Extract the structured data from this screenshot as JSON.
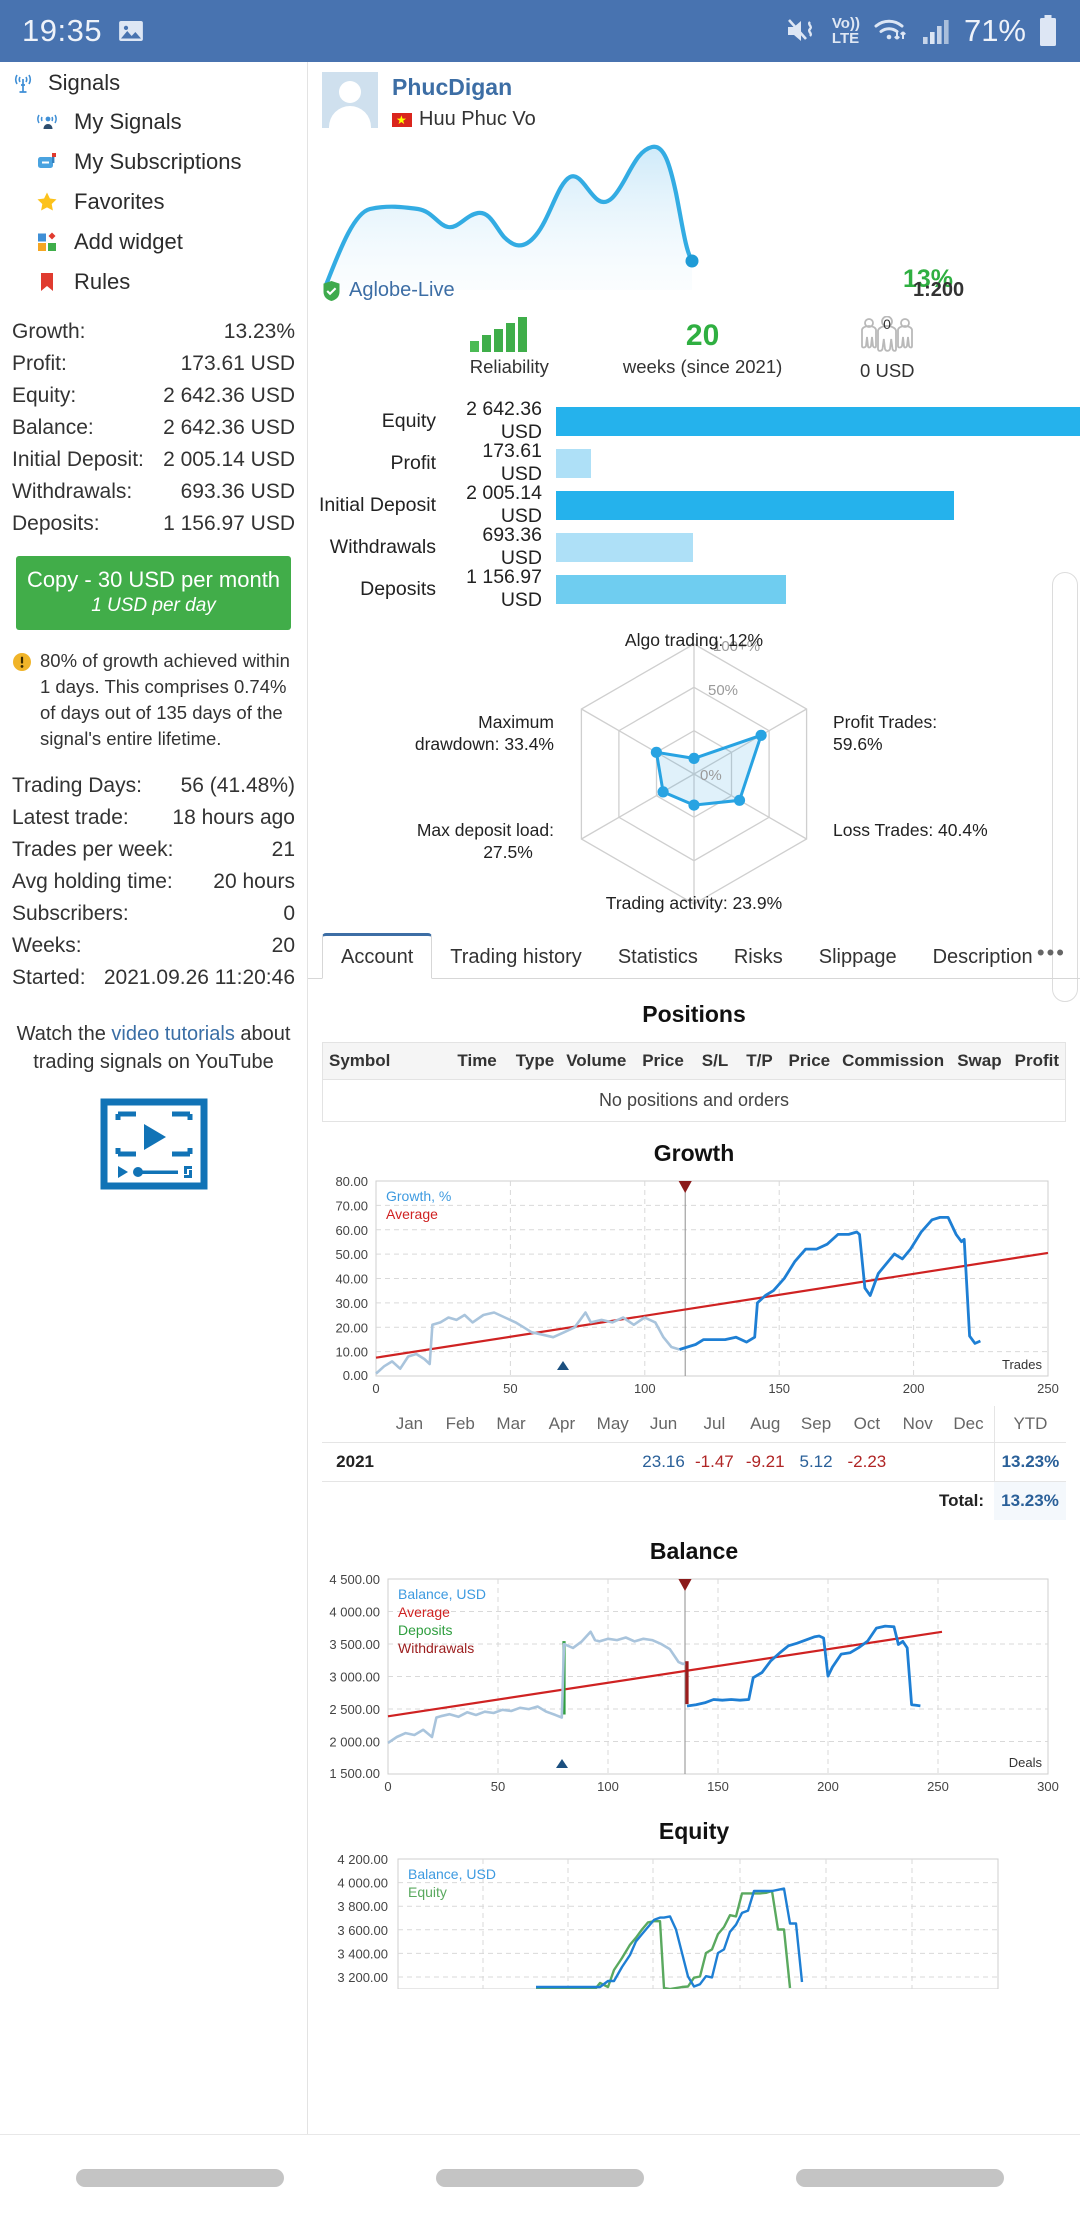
{
  "statusbar": {
    "time": "19:35",
    "battery": "71%",
    "network_label": "Vo))",
    "network_label2": "LTE",
    "icons": [
      "image-icon",
      "mute-vibrate-icon",
      "volte-icon",
      "wifi-icon",
      "signal-icon",
      "battery-icon"
    ]
  },
  "sidebar": {
    "root": {
      "label": "Signals",
      "icon": "antenna-icon"
    },
    "items": [
      {
        "label": "My Signals",
        "icon": "signal-person-icon"
      },
      {
        "label": "My Subscriptions",
        "icon": "mailbox-icon"
      },
      {
        "label": "Favorites",
        "icon": "star-icon"
      },
      {
        "label": "Add widget",
        "icon": "widget-icon"
      },
      {
        "label": "Rules",
        "icon": "bookmark-icon"
      }
    ],
    "stats": [
      {
        "key": "Growth:",
        "value": "13.23%"
      },
      {
        "key": "Profit:",
        "value": "173.61 USD"
      },
      {
        "key": "Equity:",
        "value": "2 642.36 USD"
      },
      {
        "key": "Balance:",
        "value": "2 642.36 USD"
      },
      {
        "key": "Initial Deposit:",
        "value": "2 005.14 USD"
      },
      {
        "key": "Withdrawals:",
        "value": "693.36 USD"
      },
      {
        "key": "Deposits:",
        "value": "1 156.97 USD"
      }
    ],
    "copy_button": {
      "line1": "Copy - 30 USD per month",
      "line2": "1 USD per day"
    },
    "warning": "80% of growth achieved within 1 days. This comprises 0.74% of days out of 135 days of the signal's entire lifetime.",
    "stats2": [
      {
        "key": "Trading Days:",
        "value": "56 (41.48%)"
      },
      {
        "key": "Latest trade:",
        "value": "18 hours ago"
      },
      {
        "key": "Trades per week:",
        "value": "21"
      },
      {
        "key": "Avg holding time:",
        "value": "20 hours"
      },
      {
        "key": "Subscribers:",
        "value": "0"
      },
      {
        "key": "Weeks:",
        "value": "20"
      },
      {
        "key": "Started:",
        "value": "2021.09.26 11:20:46"
      }
    ],
    "youtube": {
      "pre": "Watch the ",
      "link": "video tutorials",
      "post": " about trading signals on YouTube"
    }
  },
  "profile": {
    "name": "PhucDigan",
    "real_name": "Huu Phuc Vo",
    "country_flag": "vietnam-flag",
    "growth_percent": "13%",
    "broker": "Aglobe-Live",
    "leverage": "1:200",
    "reliability_label": "Reliability",
    "weeks_value": "20",
    "weeks_label": "weeks (since 2021)",
    "subscribers_badge": "0",
    "subscribers_value": "0 USD"
  },
  "bars": {
    "rows": [
      {
        "label": "Equity",
        "value": "2 642.36 USD",
        "pct": 100,
        "color": "#25b2ec"
      },
      {
        "label": "Profit",
        "value": "173.61 USD",
        "pct": 6.6,
        "color": "#aee0f7"
      },
      {
        "label": "Initial Deposit",
        "value": "2 005.14 USD",
        "pct": 75.9,
        "color": "#25b2ec"
      },
      {
        "label": "Withdrawals",
        "value": "693.36 USD",
        "pct": 26.2,
        "color": "#aee0f7"
      },
      {
        "label": "Deposits",
        "value": "1 156.97 USD",
        "pct": 43.8,
        "color": "#6fcdf0"
      }
    ]
  },
  "tabs": {
    "items": [
      "Account",
      "Trading history",
      "Statistics",
      "Risks",
      "Slippage",
      "Description"
    ],
    "active": "Account",
    "overflow": "•••"
  },
  "positions": {
    "title": "Positions",
    "columns": [
      "Symbol",
      "Time",
      "Type",
      "Volume",
      "Price",
      "S/L",
      "T/P",
      "Price",
      "Commission",
      "Swap",
      "Profit"
    ],
    "empty_text": "No positions and orders"
  },
  "monthly": {
    "months": [
      "Jan",
      "Feb",
      "Mar",
      "Apr",
      "May",
      "Jun",
      "Jul",
      "Aug",
      "Sep",
      "Oct",
      "Nov",
      "Dec"
    ],
    "ytd_header": "YTD",
    "year": "2021",
    "values": [
      "",
      "",
      "",
      "",
      "",
      "23.16",
      "-1.47",
      "-9.21",
      "5.12",
      "-2.23",
      "",
      ""
    ],
    "ytd": "13.23%",
    "total_label": "Total:",
    "total_value": "13.23%"
  },
  "chart_data": [
    {
      "type": "line",
      "title": "Growth",
      "xlabel": "Trades",
      "ylabel": "",
      "legend": [
        "Growth, %",
        "Average"
      ],
      "legend_colors": [
        "#3d9ae0",
        "#cf2222"
      ],
      "xlim": [
        0,
        250
      ],
      "xticks": [
        0,
        50,
        100,
        150,
        200,
        250
      ],
      "ylim": [
        0,
        80
      ],
      "yticks": [
        "0.00",
        "10.00",
        "20.00",
        "30.00",
        "40.00",
        "50.00",
        "60.00",
        "70.00",
        "80.00"
      ],
      "grid": true,
      "series": [
        {
          "name": "Growth, %",
          "color": "#1e7fd4",
          "x": [
            0,
            3,
            6,
            9,
            12,
            15,
            18,
            20,
            21,
            24,
            27,
            30,
            33,
            36,
            40,
            44,
            48,
            52,
            55,
            58,
            62,
            66,
            70,
            74,
            78,
            80,
            84,
            88,
            92,
            96,
            100,
            104,
            107,
            110,
            113,
            116,
            119,
            122,
            126,
            130,
            134,
            138,
            141,
            142,
            145,
            148,
            152,
            156,
            160,
            164,
            168,
            172,
            176,
            179,
            180,
            182,
            184,
            187,
            190,
            193,
            196,
            200,
            204,
            208,
            212,
            215,
            218,
            221,
            223,
            224,
            226,
            228,
            230
          ],
          "y": [
            1,
            4,
            6,
            3,
            8,
            9,
            7,
            5,
            21,
            22,
            24,
            23,
            25,
            22,
            24,
            23,
            26,
            27,
            25,
            24,
            23,
            22,
            18,
            20,
            26,
            22,
            23,
            22,
            24,
            21,
            23,
            22,
            16,
            12,
            11,
            12,
            13,
            15,
            15,
            15,
            16,
            14,
            16,
            30,
            33,
            35,
            40,
            47,
            52,
            52,
            54,
            58,
            58,
            59,
            58,
            36,
            33,
            42,
            46,
            50,
            53,
            51,
            55,
            62,
            67,
            68,
            68,
            60,
            57,
            58,
            16,
            13,
            14
          ]
        },
        {
          "name": "Average",
          "color": "#cf2222",
          "x": [
            0,
            230
          ],
          "y": [
            7.5,
            50.5
          ]
        }
      ],
      "annotations": [
        {
          "kind": "vline-marker",
          "x": 115,
          "color": "#8b1a1a"
        },
        {
          "kind": "x-marker",
          "x": 68,
          "color": "#1b4f7f"
        }
      ]
    },
    {
      "type": "line",
      "title": "Balance",
      "xlabel": "Deals",
      "ylabel": "",
      "legend": [
        "Balance, USD",
        "Average",
        "Deposits",
        "Withdrawals"
      ],
      "legend_colors": [
        "#3d9ae0",
        "#cf2222",
        "#2f9e3f",
        "#9b1c1c"
      ],
      "xlim": [
        0,
        300
      ],
      "xticks": [
        0,
        50,
        100,
        150,
        200,
        250,
        300
      ],
      "ylim": [
        1500,
        4500
      ],
      "yticks": [
        "1 500.00",
        "2 000.00",
        "2 500.00",
        "3 000.00",
        "3 500.00",
        "4 000.00",
        "4 500.00"
      ],
      "grid": true,
      "series": [
        {
          "name": "Balance, USD",
          "color": "#1e7fd4",
          "x": [
            0,
            4,
            8,
            12,
            16,
            20,
            22,
            24,
            28,
            32,
            36,
            40,
            44,
            48,
            52,
            56,
            60,
            64,
            68,
            72,
            76,
            79,
            80,
            84,
            88,
            92,
            94,
            96,
            100,
            104,
            108,
            112,
            116,
            120,
            124,
            128,
            132,
            134,
            135,
            136,
            140,
            144,
            148,
            152,
            156,
            160,
            164,
            166,
            170,
            174,
            178,
            182,
            186,
            190,
            194,
            198,
            200,
            202,
            204,
            206,
            210,
            214,
            218,
            222,
            226,
            230,
            234,
            238,
            242,
            244,
            246,
            248,
            250,
            252
          ],
          "y": [
            2030,
            2120,
            2180,
            2150,
            2230,
            2120,
            2420,
            2440,
            2470,
            2430,
            2500,
            2470,
            2520,
            2500,
            2550,
            2530,
            2580,
            2560,
            2600,
            2520,
            2470,
            2430,
            3560,
            3500,
            3600,
            3750,
            3620,
            3600,
            3640,
            3620,
            3660,
            3600,
            3640,
            3620,
            3560,
            3480,
            3280,
            3250,
            3260,
            2600,
            2620,
            2650,
            2700,
            2690,
            2700,
            2690,
            2700,
            3020,
            3100,
            3280,
            3400,
            3520,
            3560,
            3600,
            3650,
            3700,
            3710,
            3680,
            3060,
            3200,
            3400,
            3420,
            3500,
            3600,
            3700,
            3900,
            3930,
            3920,
            3650,
            3700,
            3600,
            2650,
            2640,
            2630
          ]
        },
        {
          "name": "Average",
          "color": "#cf2222",
          "x": [
            0,
            252
          ],
          "y": [
            2380,
            3680
          ]
        }
      ],
      "annotations": [
        {
          "kind": "deposit-bar",
          "x": 80,
          "y0": 2430,
          "y1": 3560,
          "color": "#2f9e3f"
        },
        {
          "kind": "withdrawal-bar",
          "x": 136,
          "y0": 2600,
          "y1": 3260,
          "color": "#9b1c1c"
        },
        {
          "kind": "vline-marker",
          "x": 135,
          "color": "#8b1a1a"
        },
        {
          "kind": "x-marker",
          "x": 79,
          "color": "#1b4f7f"
        }
      ]
    },
    {
      "type": "line",
      "title": "Equity",
      "xlabel": "",
      "ylabel": "",
      "legend": [
        "Balance, USD",
        "Equity"
      ],
      "legend_colors": [
        "#3d9ae0",
        "#5aa95f"
      ],
      "ylim": [
        3100,
        4200
      ],
      "yticks": [
        "3 200.00",
        "3 400.00",
        "3 600.00",
        "3 800.00",
        "4 000.00",
        "4 200.00"
      ],
      "grid": true,
      "series": [
        {
          "name": "Balance, USD",
          "color": "#1e7fd4",
          "x": [
            0,
            28,
            34,
            36,
            38,
            40,
            42,
            44,
            46,
            48,
            50,
            52,
            54,
            56,
            58,
            60,
            62,
            64,
            66,
            68,
            70,
            72,
            74,
            76,
            78,
            80,
            82,
            84,
            86,
            88,
            90,
            92,
            94,
            96,
            98,
            100
          ],
          "y": [
            3110,
            3110,
            3110,
            3160,
            3160,
            3280,
            3380,
            3500,
            3560,
            3620,
            3680,
            3700,
            3700,
            3710,
            3600,
            3400,
            3200,
            3120,
            3140,
            3210,
            3200,
            3400,
            3430,
            3560,
            3620,
            3720,
            3740,
            3900,
            3900,
            3900,
            3900,
            3910,
            3920,
            3610,
            3610,
            3110
          ]
        },
        {
          "name": "Equity",
          "color": "#5aa95f",
          "x": [
            0,
            28,
            34,
            36,
            38,
            40,
            42,
            44,
            46,
            48,
            50,
            52,
            54,
            56,
            58,
            60,
            62,
            64,
            66,
            68,
            70,
            72,
            74,
            76,
            78,
            80,
            82,
            84,
            86,
            88,
            90,
            92,
            94,
            96,
            98,
            100
          ],
          "y": [
            3100,
            3100,
            3100,
            3150,
            3120,
            3270,
            3370,
            3490,
            3550,
            3620,
            3680,
            3690,
            3690,
            3100,
            3090,
            3095,
            3100,
            3105,
            3110,
            3180,
            3190,
            3390,
            3420,
            3550,
            3610,
            3710,
            3700,
            3895,
            3895,
            3895,
            3895,
            3900,
            3915,
            3600,
            3600,
            3100
          ]
        }
      ]
    }
  ],
  "colors": {
    "statusbar": "#4873b0",
    "accent_blue": "#3d6ea5",
    "green": "#41ad49",
    "bar_blue": "#25b2ec",
    "bar_light": "#aee0f7"
  },
  "radar": {
    "axes": [
      {
        "label": "Algo trading: 12%",
        "value": 12
      },
      {
        "label": "Profit Trades: 59.6%",
        "value": 59.6
      },
      {
        "label": "Loss Trades: 40.4%",
        "value": 40.4
      },
      {
        "label": "Trading activity: 23.9%",
        "value": 23.9
      },
      {
        "label": "Max deposit load: 27.5%",
        "value": 27.5
      },
      {
        "label": "Maximum drawdown: 33.4%",
        "value": 33.4
      }
    ],
    "ring_labels": [
      "100+%",
      "50%",
      "0%"
    ]
  }
}
